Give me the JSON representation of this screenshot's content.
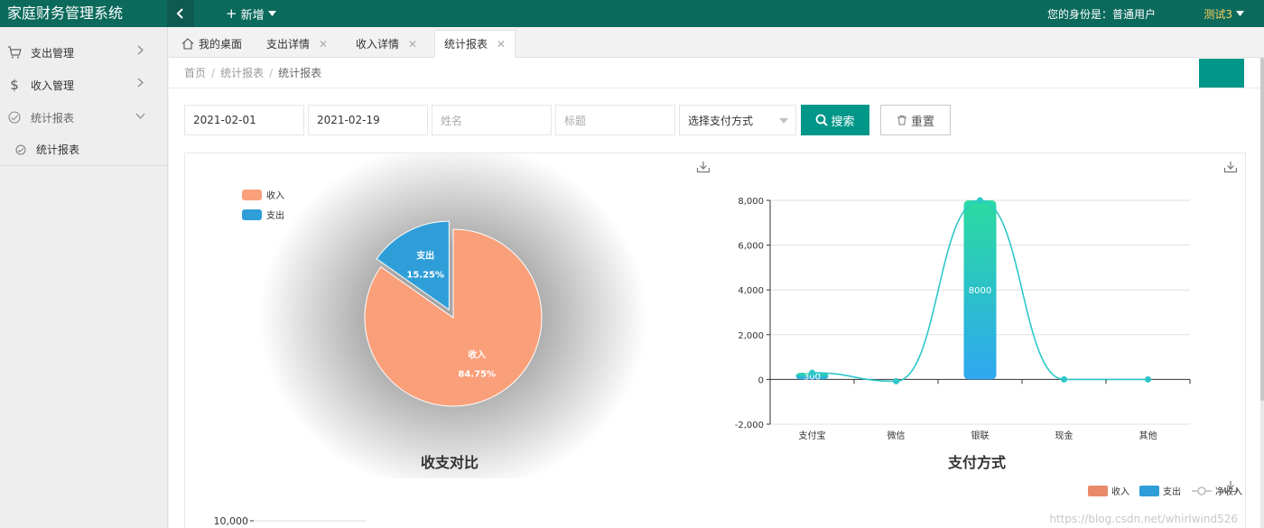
{
  "app": {
    "title": "家庭财务管理系统"
  },
  "topbar": {
    "add_label": "新增",
    "identity_text": "您的身份是：普通用户",
    "username": "测试3"
  },
  "sidebar": {
    "items": [
      {
        "label": "支出管理",
        "icon": "cart-icon"
      },
      {
        "label": "收入管理",
        "icon": "dollar-icon"
      },
      {
        "label": "统计报表",
        "icon": "clock-icon"
      }
    ],
    "sub_items": [
      {
        "label": "统计报表",
        "icon": "clock-icon"
      }
    ]
  },
  "tabs": [
    {
      "label": "我的桌面",
      "icon": "home-icon",
      "closable": false
    },
    {
      "label": "支出详情",
      "closable": true
    },
    {
      "label": "收入详情",
      "closable": true
    },
    {
      "label": "统计报表",
      "closable": true,
      "active": true
    }
  ],
  "breadcrumb": [
    "首页",
    "统计报表",
    "统计报表"
  ],
  "search": {
    "start_date": "2021-02-01",
    "end_date": "2021-02-19",
    "name_placeholder": "姓名",
    "title_placeholder": "标题",
    "payment_select": "选择支付方式",
    "search_button": "搜索",
    "reset_button": "重置"
  },
  "colors": {
    "primary": "#009688",
    "topbar": "#0b6a5c",
    "income": "#f9a07a",
    "expense": "#2f9ed8",
    "net_line": "#2ec7c9"
  },
  "watermark": "https://blog.csdn.net/whirlwind526",
  "chart_data": [
    {
      "type": "pie",
      "title": "收支对比",
      "legend": [
        "收入",
        "支出"
      ],
      "legend_position": "top-left",
      "slices": [
        {
          "name": "收入",
          "percent": 84.75,
          "label_percent": "84.75%"
        },
        {
          "name": "支出",
          "percent": 15.25,
          "label_percent": "15.25%"
        }
      ]
    },
    {
      "type": "bar",
      "title": "支付方式",
      "categories": [
        "支付宝",
        "微信",
        "银联",
        "现金",
        "其他"
      ],
      "series": [
        {
          "name": "收入",
          "type": "bar",
          "values": [
            0,
            0,
            0,
            0,
            0
          ]
        },
        {
          "name": "支出",
          "type": "bar",
          "values": [
            300,
            0,
            8000,
            0,
            0
          ]
        },
        {
          "name": "净收入",
          "type": "line",
          "values": [
            300,
            -80,
            8000,
            0,
            0
          ]
        }
      ],
      "data_labels": [
        "300",
        "8000"
      ],
      "ylim": [
        -2000,
        8000
      ],
      "yticks": [
        "8,000",
        "6,000",
        "4,000",
        "2,000",
        "0",
        "-2,000"
      ],
      "legend": [
        "收入",
        "支出",
        "净收入"
      ],
      "legend_position": "bottom-right",
      "grid": true
    },
    {
      "type": "bar",
      "title": "",
      "yticks": [
        "10,000"
      ],
      "partial": true
    }
  ]
}
